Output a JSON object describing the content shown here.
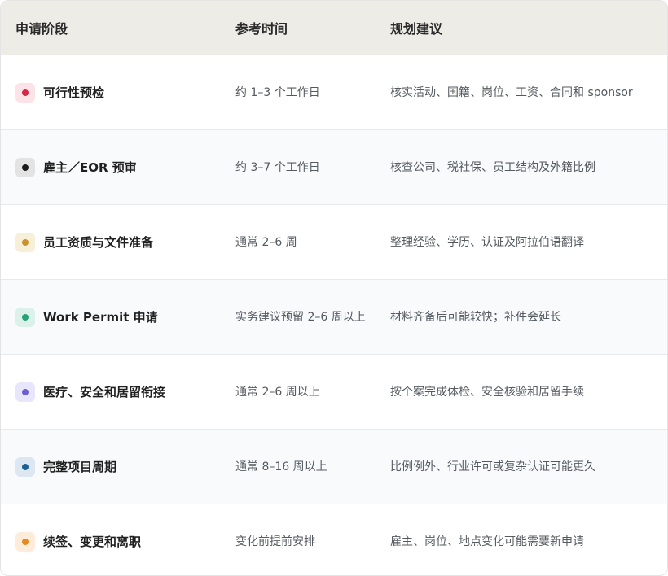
{
  "header": {
    "phase": "申请阶段",
    "time": "参考时间",
    "advice": "规划建议"
  },
  "rows": [
    {
      "phase": "可行性预检",
      "time": "约 1–3 个工作日",
      "advice": "核实活动、国籍、岗位、工资、合同和 sponsor",
      "dot_color": "#d62845",
      "dot_bg": "#fbe3e7"
    },
    {
      "phase": "雇主／EOR 预审",
      "time": "约 3–7 个工作日",
      "advice": "核查公司、税社保、员工结构及外籍比例",
      "dot_color": "#1a1a1a",
      "dot_bg": "#e3e3e3"
    },
    {
      "phase": "员工资质与文件准备",
      "time": "通常 2–6 周",
      "advice": "整理经验、学历、认证及阿拉伯语翻译",
      "dot_color": "#c8942b",
      "dot_bg": "#f8efd9"
    },
    {
      "phase": "Work Permit 申请",
      "time": "实务建议预留 2–6 周以上",
      "advice": "材料齐备后可能较快；补件会延长",
      "dot_color": "#2aa07a",
      "dot_bg": "#dcf1ea"
    },
    {
      "phase": "医疗、安全和居留衔接",
      "time": "通常 2–6 周以上",
      "advice": "按个案完成体检、安全核验和居留手续",
      "dot_color": "#6b5fd6",
      "dot_bg": "#e8e6fb"
    },
    {
      "phase": "完整项目周期",
      "time": "通常 8–16 周以上",
      "advice": "比例例外、行业许可或复杂认证可能更久",
      "dot_color": "#1e5f91",
      "dot_bg": "#dde7f1"
    },
    {
      "phase": "续签、变更和离职",
      "time": "变化前提前安排",
      "advice": "雇主、岗位、地点变化可能需要新申请",
      "dot_color": "#e58a1e",
      "dot_bg": "#fcecd9"
    }
  ]
}
